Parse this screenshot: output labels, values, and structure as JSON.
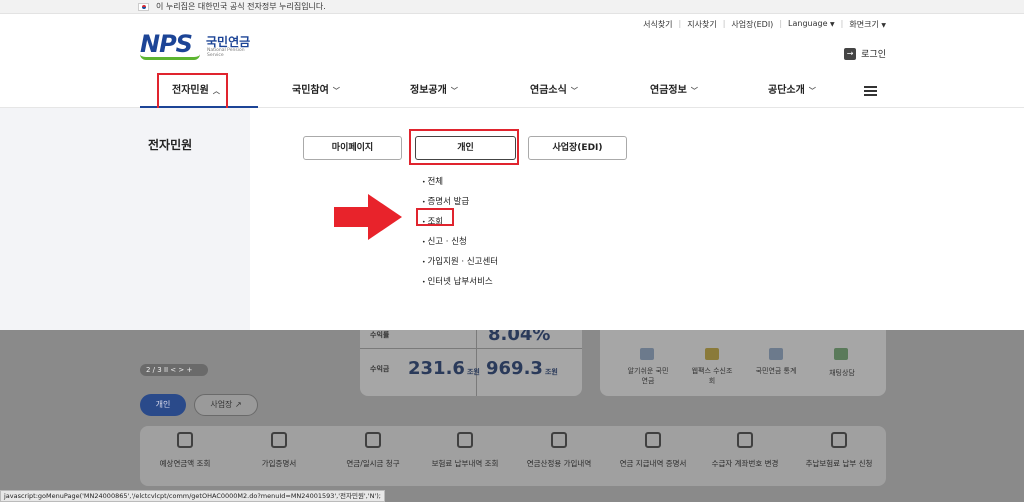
{
  "gov_banner": {
    "text": "이 누리집은 대한민국 공식 전자정부 누리집입니다."
  },
  "logo": {
    "nps": "NPS",
    "korean": "국민연금",
    "english": "National Pension Service"
  },
  "util_links": [
    "서식찾기",
    "지사찾기",
    "사업장(EDI)",
    "Language",
    "화면크기"
  ],
  "login_label": "로그인",
  "gnb": [
    {
      "label": "전자민원",
      "chevron": "up"
    },
    {
      "label": "국민참여",
      "chevron": "down"
    },
    {
      "label": "정보공개",
      "chevron": "down"
    },
    {
      "label": "연금소식",
      "chevron": "down"
    },
    {
      "label": "연금정보",
      "chevron": "down"
    },
    {
      "label": "공단소개",
      "chevron": "down"
    }
  ],
  "mega": {
    "section_title": "전자민원",
    "tabs": [
      "마이페이지",
      "개인",
      "사업장(EDI)"
    ],
    "active_tab": "개인",
    "sub_items": [
      "전체",
      "증명서 발급",
      "조회",
      "신고 · 신청",
      "가입지원 · 신고센터",
      "인터넷 납부서비스"
    ],
    "highlighted_item": "조회"
  },
  "background": {
    "pager": "2 / 3  II  < > +",
    "stat1_label": "수익률",
    "stat2_label": "수익금",
    "stat2_value1": "231.6",
    "stat2_value2": "969.3",
    "stat_unit": "조원",
    "pct_value": "8.04%",
    "personal_btn": "개인",
    "biz_btn": "사업장",
    "quick_links": [
      "알기쉬운 국민연금",
      "웹팩스 수신조회",
      "국민연금 통계",
      "채팅상담"
    ],
    "services": [
      "예상연금액 조회",
      "가입증명서",
      "연금/일시금 청구",
      "보험료 납부내역 조회",
      "연금산정용 가입내역",
      "연금 지급내역 증명서",
      "수급자 계좌번호 변경",
      "추납보험료 납부 신청"
    ]
  },
  "status_url": "javascript:goMenuPage('MN24000865','/elctcvlcpt/comm/getOHAC0000M2.do?menuId=MN24001593','전자민원','N');"
}
